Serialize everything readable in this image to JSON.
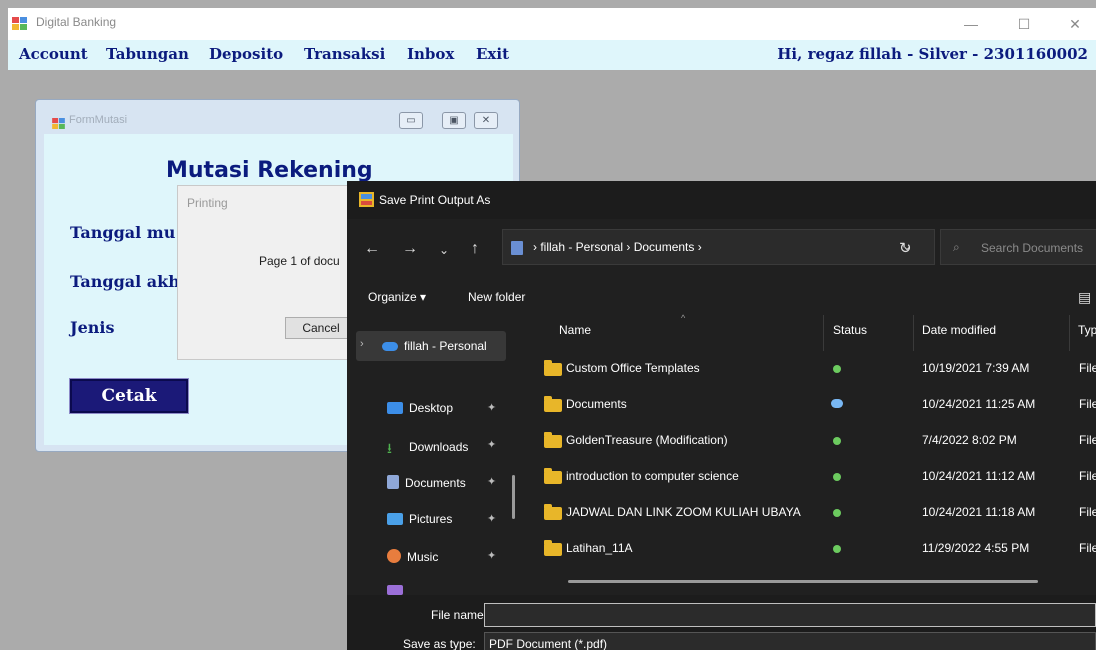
{
  "main_window": {
    "title": "Digital Banking",
    "controls": {
      "minimize": "—",
      "maximize": "☐",
      "close": "✕"
    }
  },
  "menu": {
    "items": [
      "Account",
      "Tabungan",
      "Deposito",
      "Transaksi",
      "Inbox",
      "Exit"
    ],
    "greeting": "Hi, regaz fillah - Silver - 2301160002"
  },
  "form_mutasi": {
    "title": "FormMutasi",
    "heading": "Mutasi Rekening",
    "labels": {
      "tanggal_mulai": "Tanggal mu",
      "tanggal_akhir": "Tanggal akh",
      "jenis": "Jenis"
    },
    "cetak_button": "Cetak"
  },
  "printing_dialog": {
    "title": "Printing",
    "message": "Page 1 of docu",
    "cancel_button": "Cancel"
  },
  "save_dialog": {
    "title": "Save Print Output As",
    "address": "›  fillah - Personal  ›  Documents  ›",
    "search_placeholder": "Search Documents",
    "organize": "Organize ▾",
    "new_folder": "New folder",
    "nav": {
      "onedrive": "fillah - Personal",
      "items": [
        {
          "label": "Desktop",
          "icon": "desktop-icon",
          "color": "#3c8ee8"
        },
        {
          "label": "Downloads",
          "icon": "download-icon",
          "color": "#4fb24f"
        },
        {
          "label": "Documents",
          "icon": "document-icon",
          "color": "#8fa8d8"
        },
        {
          "label": "Pictures",
          "icon": "pictures-icon",
          "color": "#4aa0e8"
        },
        {
          "label": "Music",
          "icon": "music-icon",
          "color": "#e87d3e"
        }
      ]
    },
    "columns": {
      "name": "Name",
      "status": "Status",
      "date": "Date modified",
      "type": "Typ"
    },
    "files": [
      {
        "name": "Custom Office Templates",
        "status": "synced",
        "date": "10/19/2021 7:39 AM",
        "type": "File"
      },
      {
        "name": "Documents",
        "status": "cloud",
        "date": "10/24/2021 11:25 AM",
        "type": "File"
      },
      {
        "name": "GoldenTreasure (Modification)",
        "status": "synced",
        "date": "7/4/2022 8:02 PM",
        "type": "File"
      },
      {
        "name": "introduction to computer science",
        "status": "synced",
        "date": "10/24/2021 11:12 AM",
        "type": "File"
      },
      {
        "name": "JADWAL DAN LINK ZOOM KULIAH UBAYA",
        "status": "synced",
        "date": "10/24/2021 11:18 AM",
        "type": "File"
      },
      {
        "name": "Latihan_11A",
        "status": "synced",
        "date": "11/29/2022 4:55 PM",
        "type": "File"
      }
    ],
    "file_name_label": "File name:",
    "file_name_value": "",
    "save_as_type_label": "Save as type:",
    "save_as_type_value": "PDF Document (*.pdf)"
  },
  "colors": {
    "menu_text": "#0b1b7e",
    "menu_bg": "#dff6fb",
    "dialog_bg": "#202020",
    "folder": "#e8b629",
    "status_synced": "#6ccb5f",
    "status_cloud": "#79b8f4"
  }
}
